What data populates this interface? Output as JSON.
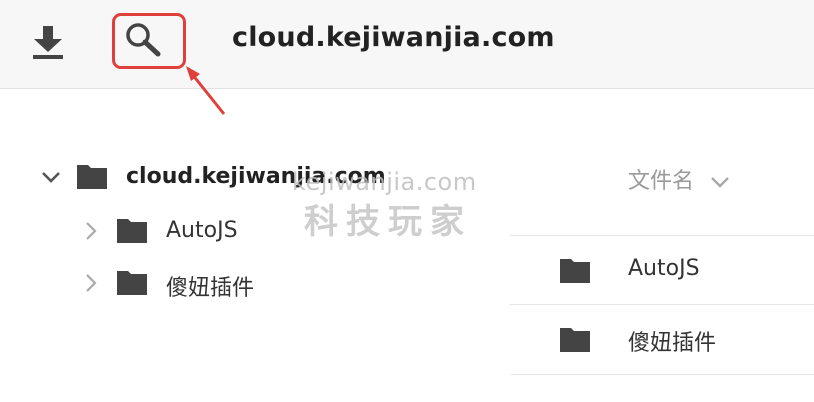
{
  "header": {
    "site_title": "cloud.kejiwanjia.com",
    "download_icon": "download-icon",
    "search_icon": "search-icon",
    "highlight_color": "#e0403c"
  },
  "tree": {
    "root_label": "cloud.kejiwanjia.com",
    "items": [
      {
        "label": "AutoJS"
      },
      {
        "label": "傻妞插件"
      }
    ]
  },
  "file_list": {
    "column_header": "文件名",
    "rows": [
      {
        "name": "AutoJS"
      },
      {
        "name": "傻妞插件"
      }
    ]
  },
  "watermark": {
    "domain": "kejiwanjia.com",
    "text": "科技玩家"
  }
}
